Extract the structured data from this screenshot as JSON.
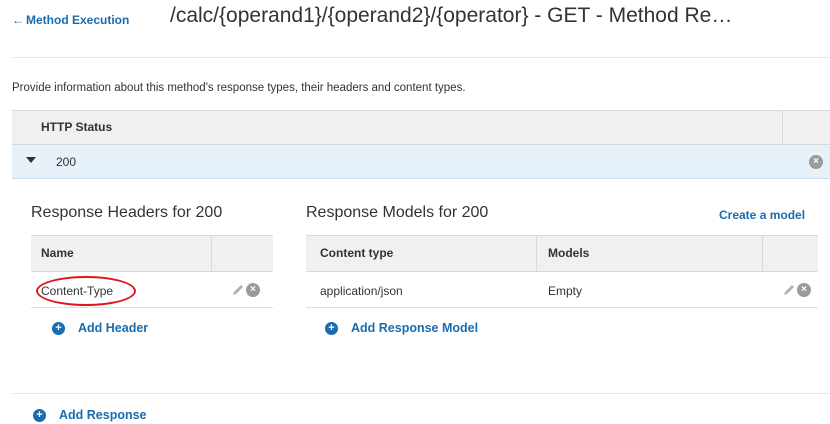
{
  "header": {
    "back_arrow": "←",
    "back_link": "Method Execution",
    "title": "/calc/{operand1}/{operand2}/{operator} - GET - Method Re…"
  },
  "intro_text": "Provide information about this method's response types, their headers and content types.",
  "status_table": {
    "column_header": "HTTP Status",
    "rows": [
      {
        "status": "200"
      }
    ]
  },
  "headers_section": {
    "title": "Response Headers for 200",
    "columns": [
      "Name"
    ],
    "rows": [
      {
        "name": "Content-Type"
      }
    ],
    "add_label": "Add Header"
  },
  "models_section": {
    "title": "Response Models for 200",
    "create_link": "Create a model",
    "columns": [
      "Content type",
      "Models"
    ],
    "rows": [
      {
        "content_type": "application/json",
        "model": "Empty"
      }
    ],
    "add_label": "Add Response Model"
  },
  "add_response_label": "Add Response",
  "icons": {
    "remove": "×",
    "add": "+",
    "expand": "caret-down-icon",
    "edit": "pencil-icon"
  },
  "colors": {
    "link": "#1a6cb0",
    "selected_row": "#e6f1fa",
    "annotation": "#e0141e"
  }
}
